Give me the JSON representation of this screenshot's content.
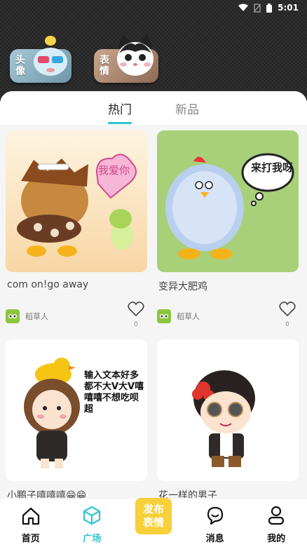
{
  "status_bar": {
    "time": "5:01"
  },
  "categories": [
    {
      "label": "头像"
    },
    {
      "label": "表情"
    }
  ],
  "tabs": [
    {
      "label": "热门",
      "active": true
    },
    {
      "label": "新品",
      "active": false
    }
  ],
  "cards": [
    {
      "title": "com on!go away",
      "author": "稻草人",
      "likes": "0",
      "bubble_text": "我爱你",
      "bg": "#fbe6c4"
    },
    {
      "title": "变异大肥鸡",
      "author": "稻草人",
      "likes": "0",
      "bubble_text": "来打我呀",
      "bg": "#a8d078"
    },
    {
      "title": "小鹏子嘻嘻嘻😁😁",
      "author": "",
      "likes": "",
      "bubble_text": "输入文本好多都不大V大V嘻嘻嘻不想吃呗超",
      "bg": "#ffffff"
    },
    {
      "title": "花一样的男子",
      "author": "",
      "likes": "",
      "bubble_text": "",
      "bg": "#ffffff"
    }
  ],
  "bottom_nav": {
    "home": "首页",
    "square": "广场",
    "publish": "发布表情",
    "messages": "消息",
    "mine": "我的"
  },
  "colors": {
    "accent": "#2fc5cf",
    "publish": "#f7d03a"
  }
}
